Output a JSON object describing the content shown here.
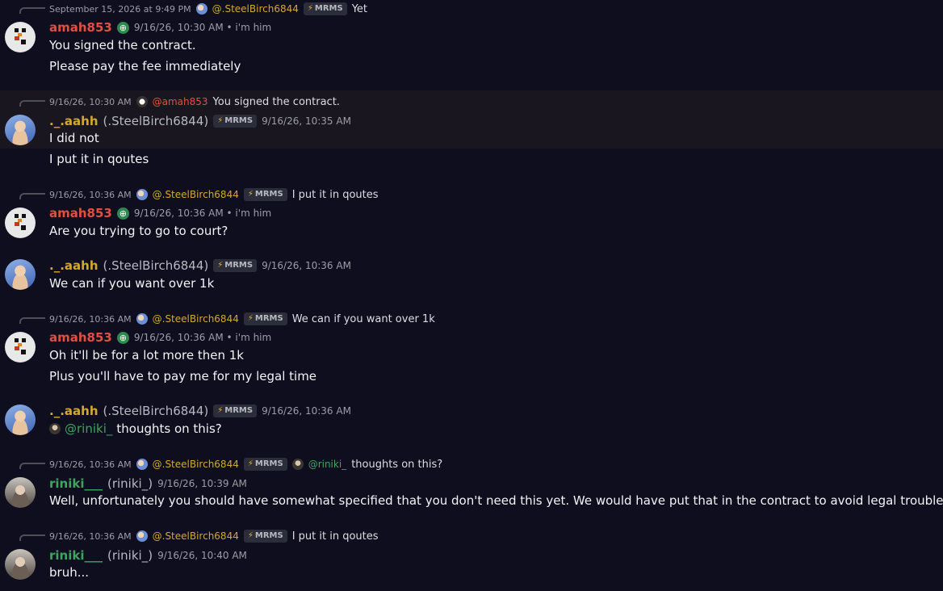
{
  "messages": [
    {
      "reply": {
        "ts": "September 15, 2026 at 9:49 PM",
        "mention": "@.SteelBirch6844",
        "tag": "MRMS",
        "preview": "Yet"
      },
      "author": "amah853",
      "time": "9/16/26, 10:30 AM • i'm him",
      "lines": [
        "You signed the contract.",
        "Please pay the fee immediately"
      ]
    },
    {
      "reply": {
        "ts": "9/16/26, 10:30 AM",
        "mention": "@amah853",
        "preview": "You signed the contract."
      },
      "author": "._.aahh",
      "display": "(.SteelBirch6844)",
      "tag": "MRMS",
      "time": "9/16/26, 10:35 AM",
      "lines": [
        "I did not",
        "I put it in qoutes"
      ]
    },
    {
      "reply": {
        "ts": "9/16/26, 10:36 AM",
        "mention": "@.SteelBirch6844",
        "tag": "MRMS",
        "preview": "I put it in qoutes"
      },
      "author": "amah853",
      "time": "9/16/26, 10:36 AM • i'm him",
      "lines": [
        "Are you trying to go to court?"
      ]
    },
    {
      "author": "._.aahh",
      "display": "(.SteelBirch6844)",
      "tag": "MRMS",
      "time": "9/16/26, 10:36 AM",
      "lines": [
        "We can if you want over 1k"
      ]
    },
    {
      "reply": {
        "ts": "9/16/26, 10:36 AM",
        "mention": "@.SteelBirch6844",
        "tag": "MRMS",
        "preview": "We can if you want over 1k"
      },
      "author": "amah853",
      "time": "9/16/26, 10:36 AM • i'm him",
      "lines": [
        "Oh it'll be for a lot more then 1k",
        "Plus you'll have to pay me for my legal time"
      ]
    },
    {
      "author": "._.aahh",
      "display": "(.SteelBirch6844)",
      "tag": "MRMS",
      "time": "9/16/26, 10:36 AM",
      "mention": "@riniki_",
      "lines": [
        "thoughts on this?"
      ]
    },
    {
      "reply": {
        "ts": "9/16/26, 10:36 AM",
        "mention": "@.SteelBirch6844",
        "tag": "MRMS",
        "mention2": "@riniki_",
        "preview": "thoughts on this?"
      },
      "author": "riniki___",
      "display": "(riniki_)",
      "time": "9/16/26, 10:39 AM",
      "lines": [
        "Well, unfortunately you should have somewhat specified that you don't need this yet. We would have put that in the contract to avoid legal trouble...."
      ]
    },
    {
      "reply": {
        "ts": "9/16/26, 10:36 AM",
        "mention": "@.SteelBirch6844",
        "tag": "MRMS",
        "preview": "I put it in qoutes"
      },
      "author": "riniki___",
      "display": "(riniki_)",
      "time": "9/16/26, 10:40 AM",
      "lines": [
        "bruh..."
      ]
    }
  ],
  "colors": {
    "amah": "#e24f3f",
    "steel": "#d4a82a",
    "riniki": "#3ba55d",
    "background": "#0f0e1f"
  },
  "icons": {
    "globe": "globe-icon",
    "bolt": "bolt-icon"
  }
}
